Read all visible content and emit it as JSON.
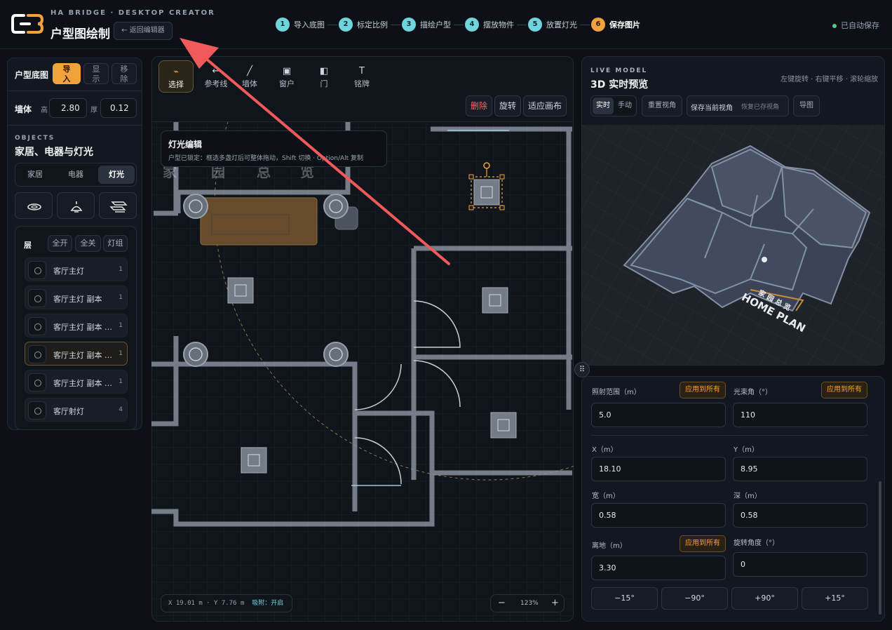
{
  "header": {
    "subtitle": "HA BRIDGE · DESKTOP CREATOR",
    "title": "户型图绘制",
    "back_label": "← 返回编辑器",
    "autosave": "已自动保存",
    "steps": [
      {
        "num": "1",
        "label": "导入底图"
      },
      {
        "num": "2",
        "label": "标定比例"
      },
      {
        "num": "3",
        "label": "描绘户型"
      },
      {
        "num": "4",
        "label": "摆放物件"
      },
      {
        "num": "5",
        "label": "放置灯光"
      },
      {
        "num": "6",
        "label": "保存图片"
      }
    ]
  },
  "left": {
    "floorplan_label": "户型底图",
    "import_label": "导入",
    "show_label": "显示",
    "remove_label": "移除",
    "wall_label": "墙体",
    "height_label": "高",
    "height_value": "2.80",
    "thickness_label": "厚",
    "thickness_value": "0.12",
    "objects_eyebrow": "OBJECTS",
    "objects_title": "家居、电器与灯光",
    "tabs": [
      "家居",
      "电器",
      "灯光"
    ],
    "layers_label": "层",
    "all_on": "全开",
    "all_off": "全关",
    "light_group": "灯组",
    "layers": [
      {
        "name": "客厅主灯",
        "count": "1"
      },
      {
        "name": "客厅主灯 副本",
        "count": "1"
      },
      {
        "name": "客厅主灯 副本 副本",
        "count": "1"
      },
      {
        "name": "客厅主灯 副本 副本 副本",
        "count": "1"
      },
      {
        "name": "客厅主灯 副本 副本 副本 副本",
        "count": "1"
      },
      {
        "name": "客厅射灯",
        "count": "4"
      }
    ]
  },
  "canvas": {
    "tools": [
      {
        "icon": "cursor-icon",
        "glyph": "⌁",
        "label": "选择"
      },
      {
        "icon": "ref-line-icon",
        "glyph": "←",
        "label": "参考线"
      },
      {
        "icon": "wall-icon",
        "glyph": "╱",
        "label": "墙体"
      },
      {
        "icon": "window-icon",
        "glyph": "▣",
        "label": "窗户"
      },
      {
        "icon": "door-icon",
        "glyph": "◧",
        "label": "门"
      },
      {
        "icon": "nameplate-icon",
        "glyph": "T",
        "label": "铭牌"
      }
    ],
    "delete_label": "删除",
    "rotate_label": "旋转",
    "fit_label": "适应画布",
    "tooltip_title": "灯光编辑",
    "tooltip_text": "户型已锁定：框选多盏灯后可整体拖动，Shift 切换 · Option/Alt 复制",
    "coords": "X 19.01 m · Y 7.76 m",
    "snap": "吸附：开启",
    "zoom": "123%",
    "zoom_out": "−",
    "zoom_in": "+",
    "plan_text": [
      "家",
      "园",
      "总",
      "览"
    ],
    "accent_color": "#f0a23c"
  },
  "preview": {
    "eyebrow": "LIVE MODEL",
    "title": "3D 实时预览",
    "hint": "左键旋转 · 右键平移 · 滚轮缩放",
    "realtime": "实时",
    "manual": "手动",
    "reset_view": "重置视角",
    "save_view": "保存当前视角",
    "restore_view": "恢复已存视角",
    "export": "导图",
    "model_label_top": "家 园 总 览",
    "model_label": "HOME PLAN"
  },
  "props": {
    "range_label": "照射范围（m）",
    "range_value": "5.0",
    "beam_label": "光束角（°）",
    "beam_value": "110",
    "apply_all": "应用到所有",
    "x_label": "X（m）",
    "x_value": "18.10",
    "y_label": "Y（m）",
    "y_value": "8.95",
    "w_label": "宽（m）",
    "w_value": "0.58",
    "d_label": "深（m）",
    "d_value": "0.58",
    "h_label": "离地（m）",
    "h_value": "3.30",
    "rot_label": "旋转角度（°）",
    "rot_value": "0",
    "rot_buttons": [
      "−15°",
      "−90°",
      "+90°",
      "+15°"
    ]
  }
}
